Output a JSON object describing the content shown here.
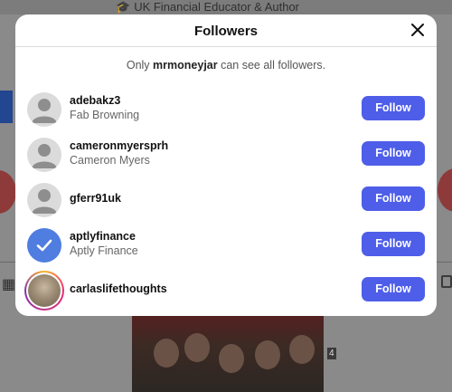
{
  "background": {
    "profile_subtitle": "UK Financial Educator & Author",
    "post_badge": "4"
  },
  "dialog": {
    "title": "Followers",
    "close_icon": "close-icon",
    "notice_prefix": "Only",
    "notice_user": "mrmoneyjar",
    "notice_suffix": "can see all followers."
  },
  "followers": [
    {
      "username": "adebakz3",
      "full_name": "Fab Browning",
      "avatar": "default",
      "button": "Follow"
    },
    {
      "username": "cameronmyersprh",
      "full_name": "Cameron Myers",
      "avatar": "default",
      "button": "Follow"
    },
    {
      "username": "gferr91uk",
      "full_name": "",
      "avatar": "default",
      "button": "Follow"
    },
    {
      "username": "aptlyfinance",
      "full_name": "Aptly Finance",
      "avatar": "checkmark",
      "button": "Follow"
    },
    {
      "username": "carlaslifethoughts",
      "full_name": "",
      "avatar": "photo-story-ring",
      "button": "Follow"
    }
  ],
  "colors": {
    "follow_button": "#4e5ee8",
    "verified_avatar": "#4f7de0",
    "overlay": "#8a8a8a"
  }
}
